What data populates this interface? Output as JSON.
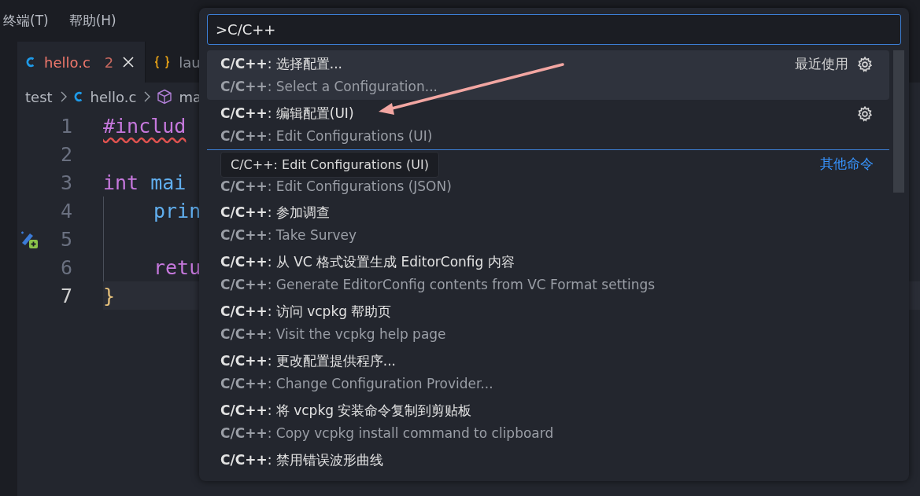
{
  "menu": [
    {
      "label": "终端(T)"
    },
    {
      "label": "帮助(H)"
    }
  ],
  "tabs": [
    {
      "label": "hello.c",
      "kind": "c",
      "problems": "2",
      "selected": true
    },
    {
      "label": "lau",
      "kind": "json",
      "selected": false
    }
  ],
  "breadcrumb": [
    {
      "label": "test",
      "kind": "folder"
    },
    {
      "label": "hello.c",
      "kind": "c"
    },
    {
      "label": "ma",
      "kind": "symbol"
    }
  ],
  "editor": {
    "lines": [
      {
        "number": "1",
        "active": false,
        "glyph": false,
        "indent": false,
        "tokens": [
          {
            "text": "#includ",
            "kind": "keyword",
            "error": true
          }
        ]
      },
      {
        "number": "2",
        "active": false,
        "glyph": false,
        "indent": false
      },
      {
        "number": "3",
        "active": false,
        "glyph": false,
        "indent": false,
        "tokens": [
          {
            "text": "int",
            "kind": "keyword",
            "error": false
          },
          {
            "text": "mai",
            "kind": "function",
            "error": false
          }
        ]
      },
      {
        "number": "4",
        "active": false,
        "glyph": false,
        "indent": true,
        "tokens": [
          {
            "text": "prin",
            "kind": "function",
            "error": false
          }
        ]
      },
      {
        "number": "5",
        "active": false,
        "glyph": true,
        "indent": true
      },
      {
        "number": "6",
        "active": false,
        "glyph": false,
        "indent": true,
        "tokens": [
          {
            "text": "retu",
            "kind": "keyword",
            "error": false
          }
        ]
      },
      {
        "number": "7",
        "active": true,
        "glyph": false,
        "indent": false,
        "tokens": [
          {
            "text": "}",
            "kind": "brace",
            "error": false
          }
        ]
      }
    ]
  },
  "palette": {
    "value": ">C/C++",
    "items": [
      {
        "title": "**C/C++**: 选择配置...",
        "description": "**C/C++**: Select a Configuration...",
        "label": "最近使用",
        "gear": true,
        "selected": true,
        "separator": false
      },
      {
        "title": "**C/C++**: 编辑配置(UI)",
        "description": "**C/C++**: Edit Configurations (UI)",
        "gear": true,
        "selected": false,
        "separator": false
      },
      {
        "description": "**C/C++**: Edit Configurations (JSON)",
        "label": "其他命令",
        "gear": false,
        "selected": false,
        "separator": true
      },
      {
        "title": "**C/C++**: 参加调查",
        "description": "**C/C++**: Take Survey",
        "gear": false,
        "selected": false,
        "separator": false
      },
      {
        "title": "**C/C++**: 从 VC 格式设置生成 EditorConfig 内容",
        "description": "**C/C++**: Generate EditorConfig contents from VC Format settings",
        "gear": false,
        "selected": false,
        "separator": false
      },
      {
        "title": "**C/C++**: 访问 vcpkg 帮助页",
        "description": "**C/C++**: Visit the vcpkg help page",
        "gear": false,
        "selected": false,
        "separator": false
      },
      {
        "title": "**C/C++**: 更改配置提供程序...",
        "description": "**C/C++**: Change Configuration Provider...",
        "gear": false,
        "selected": false,
        "separator": false
      },
      {
        "title": "**C/C++**: 将 vcpkg 安装命令复制到剪贴板",
        "description": "**C/C++**: Copy vcpkg install command to clipboard",
        "gear": false,
        "selected": false,
        "separator": false
      },
      {
        "title": "**C/C++**: 禁用错误波形曲线",
        "gear": false,
        "selected": false,
        "separator": false
      }
    ],
    "tooltip": "C/C++: Edit Configurations (UI)"
  }
}
